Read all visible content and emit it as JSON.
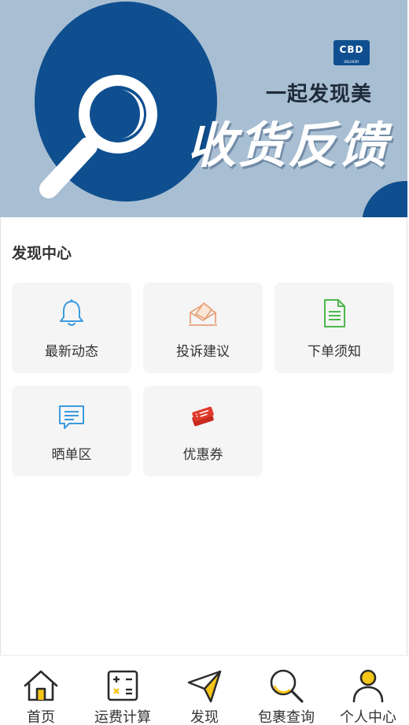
{
  "banner": {
    "logo_text": "CBD",
    "logo_small": "DELIVERY",
    "subtitle": "一起发现美",
    "title": "收货反馈",
    "colors": {
      "background": "#a8bed2",
      "accent": "#0f4f8f"
    }
  },
  "section": {
    "title": "发现中心"
  },
  "cards": [
    {
      "label": "最新动态",
      "icon": "bell-icon"
    },
    {
      "label": "投诉建议",
      "icon": "envelope-icon"
    },
    {
      "label": "下单须知",
      "icon": "document-icon"
    },
    {
      "label": "晒单区",
      "icon": "chat-bubble-icon"
    },
    {
      "label": "优惠券",
      "icon": "coupon-icon"
    }
  ],
  "tabbar": {
    "active_index": 2,
    "items": [
      {
        "label": "首页",
        "icon": "home-icon"
      },
      {
        "label": "运费计算",
        "icon": "calculator-icon"
      },
      {
        "label": "发现",
        "icon": "paper-plane-icon"
      },
      {
        "label": "包裹查询",
        "icon": "search-icon"
      },
      {
        "label": "个人中心",
        "icon": "user-icon"
      }
    ]
  }
}
